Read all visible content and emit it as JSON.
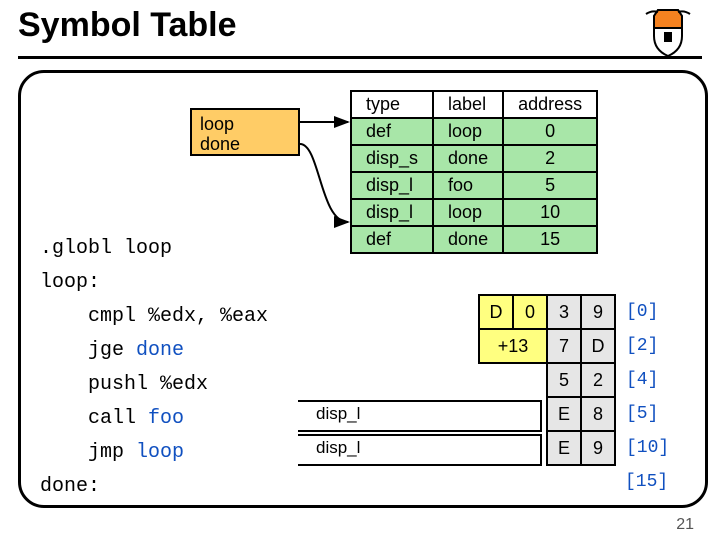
{
  "title": "Symbol Table",
  "page_number": "21",
  "sym_box": {
    "line1": "loop",
    "line2": "done"
  },
  "green_table": {
    "headers": {
      "type": "type",
      "label": "label",
      "address": "address"
    },
    "rows": [
      {
        "type": "def",
        "label": "loop",
        "address": "0"
      },
      {
        "type": "disp_s",
        "label": "done",
        "address": "2"
      },
      {
        "type": "disp_l",
        "label": "foo",
        "address": "5"
      },
      {
        "type": "disp_l",
        "label": "loop",
        "address": "10"
      },
      {
        "type": "def",
        "label": "done",
        "address": "15"
      }
    ]
  },
  "code": {
    "l0": ".globl loop",
    "l1": "loop:",
    "l2": "    cmpl %edx, %eax",
    "l3a": "    jge ",
    "l3b": "done",
    "l4": "    pushl %edx",
    "l5a": "    call ",
    "l5b": "foo",
    "l6a": "    jmp ",
    "l6b": "loop",
    "l7": "done:"
  },
  "disp_labels": {
    "a": "disp_l",
    "b": "disp_l"
  },
  "bytes": {
    "rows": [
      {
        "cells": [
          "D",
          "0",
          "3",
          "9"
        ],
        "yellow": [
          0,
          1
        ],
        "addr": "[0]"
      },
      {
        "cells": [
          "+13",
          "7",
          "D"
        ],
        "wide0": true,
        "yellow": [
          0
        ],
        "addr": "[2]"
      },
      {
        "cells": [
          "",
          "",
          "5",
          "2"
        ],
        "addr": "[4]"
      },
      {
        "cells": [
          "",
          "",
          "E",
          "8"
        ],
        "addr": "[5]"
      },
      {
        "cells": [
          "",
          "",
          "E",
          "9"
        ],
        "addr": "[10]"
      },
      {
        "cells": [
          "",
          "",
          "",
          ""
        ],
        "addr": "[15]",
        "empty": true
      }
    ]
  }
}
